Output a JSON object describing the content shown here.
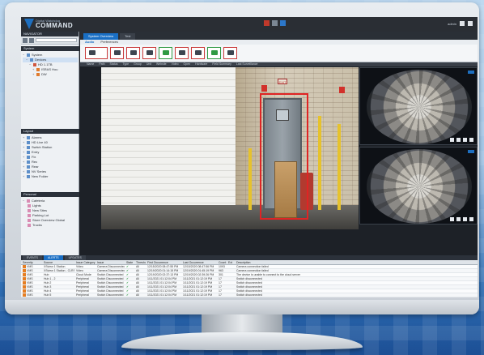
{
  "app": {
    "logo_line1": "Digital Watchdog",
    "logo_line2": "COMMAND",
    "user_label": "admin"
  },
  "left_panel": {
    "navigator_title": "NAVIGATOR",
    "system_title": "System",
    "system_items": [
      "System",
      "Devices",
      "HD 1.1TB",
      "ISRAS Hou",
      "DW"
    ],
    "layout_title": "Layout",
    "layout_items": [
      "Alarms",
      "HD Live 40",
      "Switch Station",
      "Entry",
      "Fix",
      "Rec",
      "Rear",
      "NV Series",
      "New Folder"
    ],
    "personal_title": "Personal",
    "personal_items": [
      "Cafeteria",
      "Lights",
      "New Sites",
      "Parking Lot",
      "Store Overview Global",
      "Trucks"
    ]
  },
  "main": {
    "tabs": [
      "System Overview",
      "Test"
    ],
    "subtabs": [
      "Audio",
      "Preferences"
    ],
    "columns": [
      "Name",
      "Path",
      "Status",
      "Type",
      "Group",
      "Unit",
      "Website",
      "Video",
      "Open",
      "Hardware",
      "Field Summary",
      "Last Surveillance"
    ]
  },
  "bottom": {
    "tabs": [
      "EVENTS",
      "ALERTS",
      "UPDATES"
    ],
    "headers": [
      "Severity",
      "Source",
      "Issue Category",
      "Issue",
      "State",
      "Threshold",
      "First Occurrence",
      "Last Occurrence",
      "Count",
      "Ext",
      "Description"
    ],
    "rows": [
      [
        "VMS",
        "XSview 1 Station",
        "Video",
        "Camera Disconnected",
        "✔",
        "All",
        "12/15/2020 08:47:55 PM",
        "12/15/2020 08:47:56 PM",
        "1093",
        "",
        "Camera connection failed"
      ],
      [
        "VMS",
        "XSview 1 Station - CLRSys",
        "Video",
        "Camera Disconnected",
        "✔",
        "All",
        "12/19/2020 01:14:15 PM",
        "12/19/2020 01:45:19 PM",
        "963",
        "",
        "Camera connection failed"
      ],
      [
        "VMS",
        "Hub",
        "Cloud Mode",
        "Switch Disconnected",
        "✔",
        "All",
        "12/19/2020 02:37:13 PM",
        "12/19/2020 02:39:26 PM",
        "301",
        "",
        "The device is unable to connect to the cloud server"
      ],
      [
        "VMS",
        "Hub 1 - 2",
        "Peripheral",
        "Switch Disconnected",
        "✔",
        "All",
        "1/11/2021 01:12:04 PM",
        "1/11/2021 01:12:19 PM",
        "17",
        "",
        "Switch disconnected"
      ],
      [
        "VMS",
        "Hub 2",
        "Peripheral",
        "Switch Disconnected",
        "✔",
        "All",
        "1/11/2021 01:12:04 PM",
        "1/11/2021 01:12:19 PM",
        "17",
        "",
        "Switch disconnected"
      ],
      [
        "VMS",
        "Hub 3",
        "Peripheral",
        "Switch Disconnected",
        "✔",
        "All",
        "1/11/2021 01:12:04 PM",
        "1/11/2021 01:12:19 PM",
        "17",
        "",
        "Switch disconnected"
      ],
      [
        "VMS",
        "Hub 4",
        "Peripheral",
        "Switch Disconnected",
        "✔",
        "All",
        "1/11/2021 01:12:04 PM",
        "1/11/2021 01:12:19 PM",
        "17",
        "",
        "Switch disconnected"
      ],
      [
        "VMS",
        "Hub 5",
        "Peripheral",
        "Switch Disconnected",
        "✔",
        "All",
        "1/11/2021 01:12:04 PM",
        "1/11/2021 01:12:19 PM",
        "17",
        "",
        "Switch disconnected"
      ]
    ]
  },
  "video": {
    "exit_sign": "EXIT"
  },
  "colors": {
    "accent": "#1a6fc4",
    "detection": "#e02424",
    "ok": "#2f9a43"
  }
}
